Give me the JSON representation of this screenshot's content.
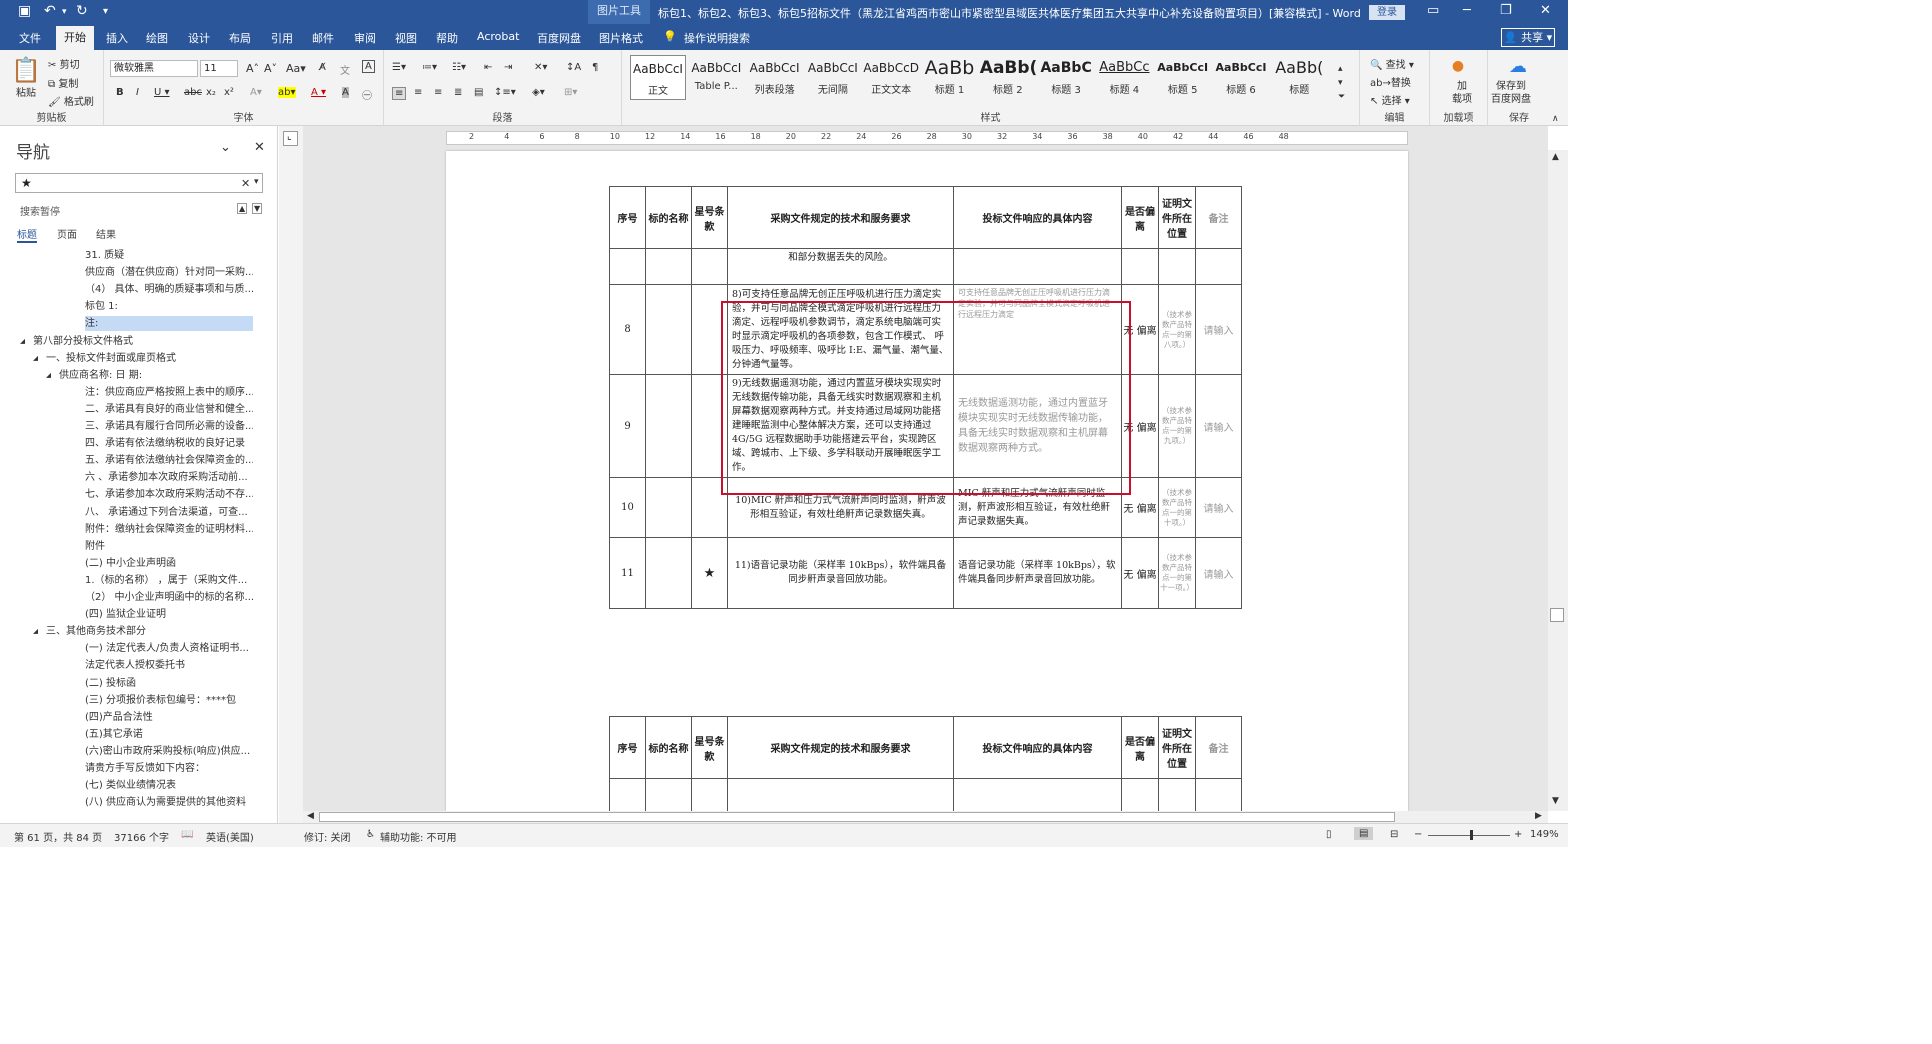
{
  "title": {
    "context_tab": "图片工具",
    "doc_title": "标包1、标包2、标包3、标包5招标文件（黑龙江省鸡西市密山市紧密型县域医共体医疗集团五大共享中心补充设备购置项目）[兼容模式] - Word",
    "login": "登录"
  },
  "tabs": [
    "文件",
    "开始",
    "插入",
    "绘图",
    "设计",
    "布局",
    "引用",
    "邮件",
    "审阅",
    "视图",
    "帮助",
    "Acrobat",
    "百度网盘",
    "图片格式"
  ],
  "tell_me": "操作说明搜索",
  "share": "共享",
  "ribbon": {
    "clipboard": {
      "paste": "粘贴",
      "cut": "剪切",
      "copy": "复制",
      "format_painter": "格式刷",
      "label": "剪贴板"
    },
    "font": {
      "name": "微软雅黑",
      "size": "11",
      "label": "字体"
    },
    "paragraph": {
      "label": "段落"
    },
    "styles": {
      "label": "样式",
      "items": [
        {
          "sample": "AaBbCcI",
          "name": "正文"
        },
        {
          "sample": "AaBbCcI",
          "name": "Table P..."
        },
        {
          "sample": "AaBbCcI",
          "name": "列表段落"
        },
        {
          "sample": "AaBbCcI",
          "name": "无间隔"
        },
        {
          "sample": "AaBbCcD",
          "name": "正文文本"
        },
        {
          "sample": "AaBb",
          "name": "标题 1"
        },
        {
          "sample": "AaBb(",
          "name": "标题 2"
        },
        {
          "sample": "AaBbC",
          "name": "标题 3"
        },
        {
          "sample": "AaBbCc",
          "name": "标题 4"
        },
        {
          "sample": "AaBbCcI",
          "name": "标题 5"
        },
        {
          "sample": "AaBbCcI",
          "name": "标题 6"
        },
        {
          "sample": "AaBb(",
          "name": "标题"
        }
      ]
    },
    "editing": {
      "find": "查找",
      "replace": "替换",
      "select": "选择",
      "label": "编辑"
    },
    "addins": {
      "add": "加\n载项",
      "label": "加载项"
    },
    "save": {
      "save_to": "保存到\n百度网盘",
      "label": "保存"
    }
  },
  "nav": {
    "title": "导航",
    "search_value": "★",
    "status": "搜索暂停",
    "tabs": [
      "标题",
      "页面",
      "结果"
    ],
    "items": [
      {
        "text": "31. 质疑",
        "indent": 85
      },
      {
        "text": "供应商（潜在供应商）针对同一采购...",
        "indent": 85
      },
      {
        "text": "（4）  具体、明确的质疑事项和与质...",
        "indent": 85
      },
      {
        "text": "标包 1:",
        "indent": 85
      },
      {
        "text": "注:",
        "indent": 85,
        "selected": true
      },
      {
        "text": "第八部分投标文件格式",
        "indent": 33,
        "expander": "◢"
      },
      {
        "text": "一、投标文件封面或扉页格式",
        "indent": 46,
        "expander": "◢"
      },
      {
        "text": "供应商名称:                        日 期:",
        "indent": 59,
        "expander": "◢"
      },
      {
        "text": "注：供应商应严格按照上表中的顺序...",
        "indent": 85
      },
      {
        "text": "二、承诺具有良好的商业信誉和健全...",
        "indent": 85
      },
      {
        "text": "三、承诺具有履行合同所必需的设备...",
        "indent": 85
      },
      {
        "text": "四、承诺有依法缴纳税收的良好记录",
        "indent": 85
      },
      {
        "text": "五、承诺有依法缴纳社会保障资金的...",
        "indent": 85
      },
      {
        "text": "六 、承诺参加本次政府采购活动前...",
        "indent": 85
      },
      {
        "text": "七、承诺参加本次政府采购活动不存...",
        "indent": 85
      },
      {
        "text": "八、 承诺通过下列合法渠道，可查...",
        "indent": 85
      },
      {
        "text": "附件：缴纳社会保障资金的证明材料...",
        "indent": 85
      },
      {
        "text": "附件",
        "indent": 85
      },
      {
        "text": "(二) 中小企业声明函",
        "indent": 85
      },
      {
        "text": "1.（标的名称）    ，属于（采购文件...",
        "indent": 85
      },
      {
        "text": "（2）  中小企业声明函中的标的名称...",
        "indent": 85
      },
      {
        "text": "(四) 监狱企业证明",
        "indent": 85
      },
      {
        "text": "三、其他商务技术部分",
        "indent": 46,
        "expander": "◢"
      },
      {
        "text": "(一) 法定代表人/负责人资格证明书...",
        "indent": 85
      },
      {
        "text": "法定代表人授权委托书",
        "indent": 85
      },
      {
        "text": "(二) 投标函",
        "indent": 85
      },
      {
        "text": "(三) 分项报价表标包编号：****包",
        "indent": 85
      },
      {
        "text": "(四)产品合法性",
        "indent": 85
      },
      {
        "text": "(五)其它承诺",
        "indent": 85
      },
      {
        "text": "(六)密山市政府采购投标(响应)供应...",
        "indent": 85
      },
      {
        "text": "请贵方手写反馈如下内容：",
        "indent": 85
      },
      {
        "text": "(七) 类似业绩情况表",
        "indent": 85
      },
      {
        "text": "(八) 供应商认为需要提供的其他资料",
        "indent": 85
      }
    ]
  },
  "table": {
    "headers": [
      "序号",
      "标的名称",
      "星号条款",
      "采购文件规定的技术和服务要求",
      "投标文件响应的具体内容",
      "是否偏离",
      "证明文件所在位置",
      "备注"
    ],
    "continuation_text": "和部分数据丢失的风险。",
    "rows": [
      {
        "no": "8",
        "star": "",
        "req": "8)可支持任意品牌无创正压呼吸机进行压力滴定实验，并可与同品牌全模式滴定呼吸机进行远程压力滴定、远程呼吸机参数调节，滴定系统电脑端可实时显示滴定呼吸机的各项参数，包含工作模式、 呼吸压力、呼吸频率、吸呼比 I:E、漏气量、潮气量、分钟通气量等。",
        "resp": "可支持任意品牌无创正压呼吸机进行压力滴定实验，并可与同品牌全模式滴定呼吸机进行远程压力滴定",
        "dev": "无 偏离",
        "proof": "（技术参数产品特点一的第八项。）",
        "note": "请输入"
      },
      {
        "no": "9",
        "star": "",
        "req": "9)无线数据遥测功能，通过内置蓝牙模块实现实时无线数据传输功能，具备无线实时数据观察和主机屏幕数据观察两种方式。并支持通过局域网功能搭建睡眠监测中心整体解决方案，还可以支持通过 4G/5G 远程数据助手功能搭建云平台，实现跨区域、跨城市、上下级、多学科联动开展睡眠医学工作。",
        "resp": "无线数据遥测功能，通过内置蓝牙模块实现实时无线数据传输功能，具备无线实时数据观察和主机屏幕数据观察两种方式。",
        "dev": "无 偏离",
        "proof": "（技术参数产品特点一的第九项。）",
        "note": "请输入"
      },
      {
        "no": "10",
        "star": "",
        "req": "10)MIC 鼾声和压力式气流鼾声同时监测，鼾声波形相互验证，有效杜绝鼾声记录数据失真。",
        "resp": "MIC 鼾声和压力式气流鼾声同时监测，鼾声波形相互验证，有效杜绝鼾声记录数据失真。",
        "dev": "无 偏离",
        "proof": "（技术参数产品特点一的第十项。）",
        "note": "请输入"
      },
      {
        "no": "11",
        "star": "★",
        "req": "11)语音记录功能（采样率 10kBps），软件端具备同步鼾声录音回放功能。",
        "resp": "语音记录功能（采样率 10kBps），软件端具备同步鼾声录音回放功能。",
        "dev": "无 偏离",
        "proof": "（技术参数产品特点一的第十一项。）",
        "note": "请输入"
      }
    ]
  },
  "ruler_numbers": [
    "2",
    "4",
    "6",
    "8",
    "10",
    "12",
    "14",
    "16",
    "18",
    "20",
    "22",
    "24",
    "26",
    "28",
    "30",
    "32",
    "34",
    "36",
    "38",
    "40",
    "42",
    "44",
    "46",
    "48"
  ],
  "status": {
    "page": "第 61 页，共 84 页",
    "words": "37166 个字",
    "lang": "英语(美国)",
    "track": "修订: 关闭",
    "access": "辅助功能: 不可用",
    "zoom": "149%"
  }
}
